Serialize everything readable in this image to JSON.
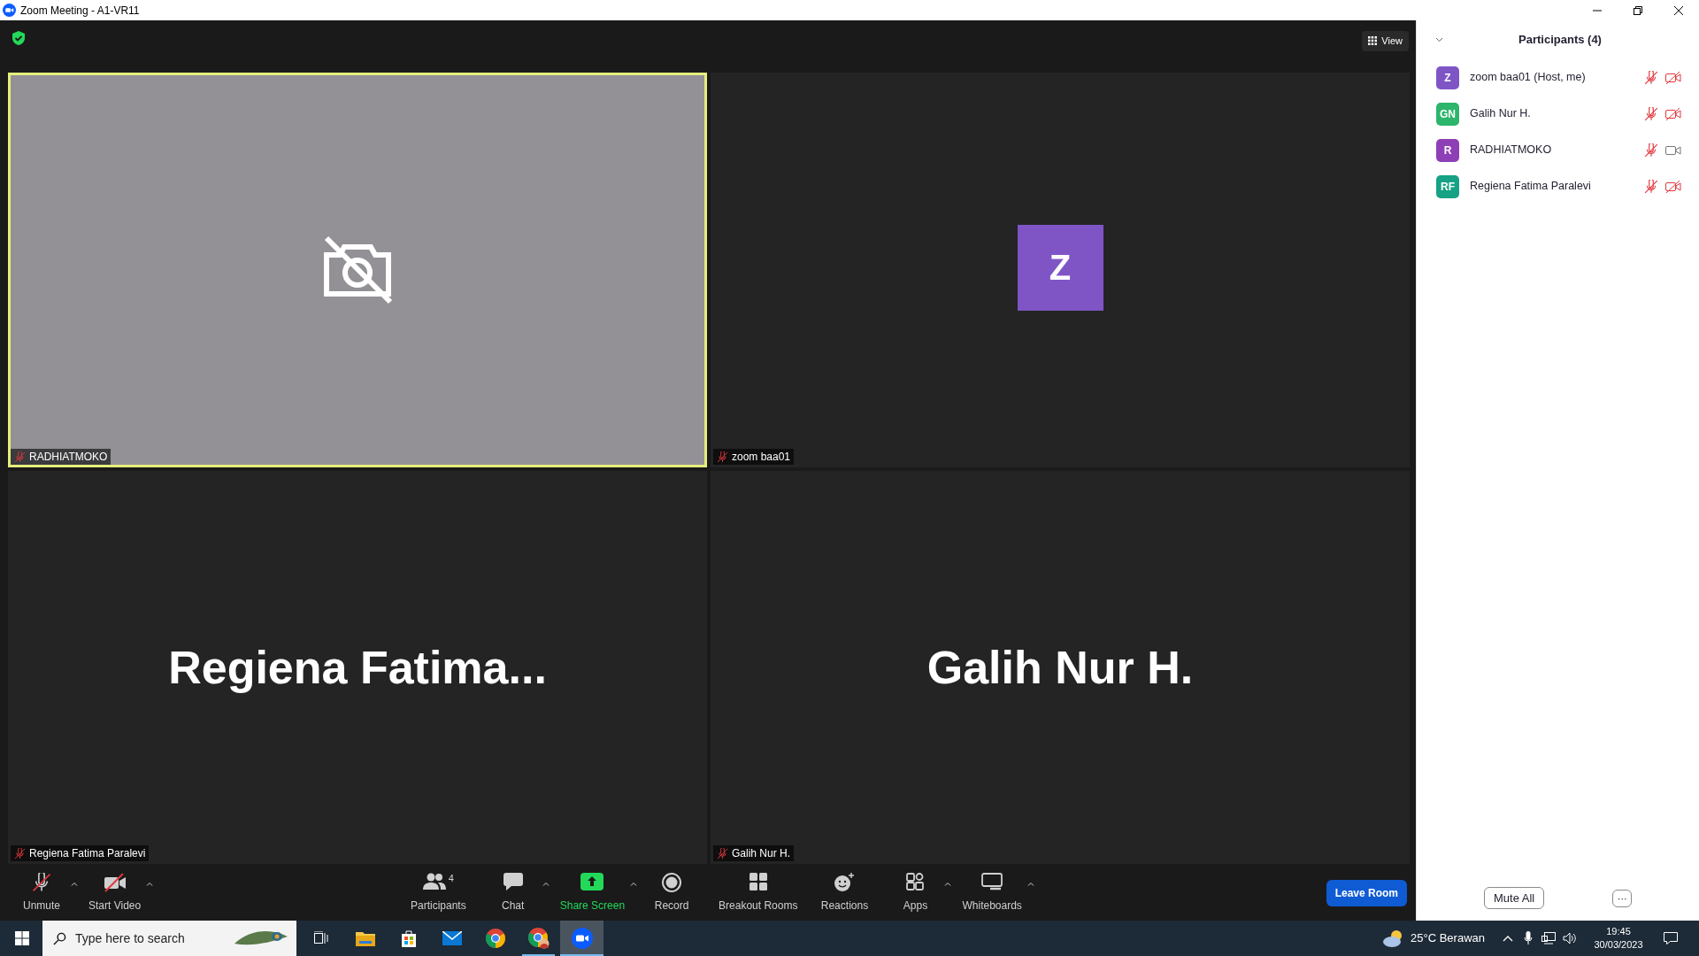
{
  "window": {
    "title": "Zoom Meeting - A1-VR11"
  },
  "top_bar": {
    "view_label": "View"
  },
  "tile_rows": [
    {
      "tiles": [
        {
          "kind": "camera-off",
          "name": "RADHIATMOKO",
          "muted": true,
          "active_speaker": true
        },
        {
          "kind": "avatar",
          "name": "zoom baa01",
          "muted": true,
          "active_speaker": false,
          "initial": "Z",
          "color": "#7f55c6"
        }
      ]
    },
    {
      "tiles": [
        {
          "kind": "name",
          "name": "Regiena Fatima Paralevi",
          "muted": true,
          "active_speaker": false,
          "display": "Regiena Fatima..."
        },
        {
          "kind": "name",
          "name": "Galih Nur H.",
          "muted": true,
          "active_speaker": false,
          "display": "Galih Nur H."
        }
      ]
    }
  ],
  "toolbar": {
    "left_items": [
      {
        "kind": "mic",
        "label": "Unmute",
        "caret": true,
        "accent": false
      },
      {
        "kind": "video",
        "label": "Start Video",
        "caret": true,
        "accent": false
      }
    ],
    "items": [
      {
        "kind": "participants",
        "label": "Participants",
        "count": "4",
        "caret": false,
        "accent": false
      },
      {
        "kind": "chat",
        "label": "Chat",
        "caret": true,
        "accent": false
      },
      {
        "kind": "share",
        "label": "Share Screen",
        "caret": true,
        "accent": true
      },
      {
        "kind": "record",
        "label": "Record",
        "caret": false,
        "accent": false
      },
      {
        "kind": "breakout",
        "label": "Breakout Rooms",
        "caret": false,
        "accent": false
      },
      {
        "kind": "reactions",
        "label": "Reactions",
        "caret": false,
        "accent": false
      },
      {
        "kind": "apps",
        "label": "Apps",
        "caret": true,
        "accent": false
      },
      {
        "kind": "whiteboard",
        "label": "Whiteboards",
        "caret": true,
        "accent": false
      }
    ],
    "leave_label": "Leave Room"
  },
  "participants_panel": {
    "title": "Participants (4)",
    "people": [
      {
        "initials": "Z",
        "name": "zoom baa01 (Host, me)",
        "color": "#7f55c6",
        "muted": true,
        "video_off": true
      },
      {
        "initials": "GN",
        "name": "Galih Nur H.",
        "color": "#2db56b",
        "muted": true,
        "video_off": true
      },
      {
        "initials": "R",
        "name": "RADHIATMOKO",
        "color": "#8e3fb5",
        "muted": true,
        "video_off": false
      },
      {
        "initials": "RF",
        "name": "Regiena Fatima Paralevi",
        "color": "#17a185",
        "muted": true,
        "video_off": true
      }
    ],
    "mute_all_label": "Mute All",
    "more_label": "···"
  },
  "taskbar": {
    "search_placeholder": "Type here to search",
    "apps": [
      {
        "kind": "task-view",
        "running": false,
        "selected": false
      },
      {
        "kind": "folder",
        "running": false,
        "selected": false
      },
      {
        "kind": "store",
        "running": false,
        "selected": false
      },
      {
        "kind": "mail",
        "running": false,
        "selected": false
      },
      {
        "kind": "chrome",
        "running": false,
        "selected": false
      },
      {
        "kind": "chrome-profile",
        "running": true,
        "selected": false
      },
      {
        "kind": "zoom",
        "running": true,
        "selected": true
      }
    ],
    "weather": "25°C Berawan",
    "time": "19:45",
    "date": "30/03/2023"
  }
}
